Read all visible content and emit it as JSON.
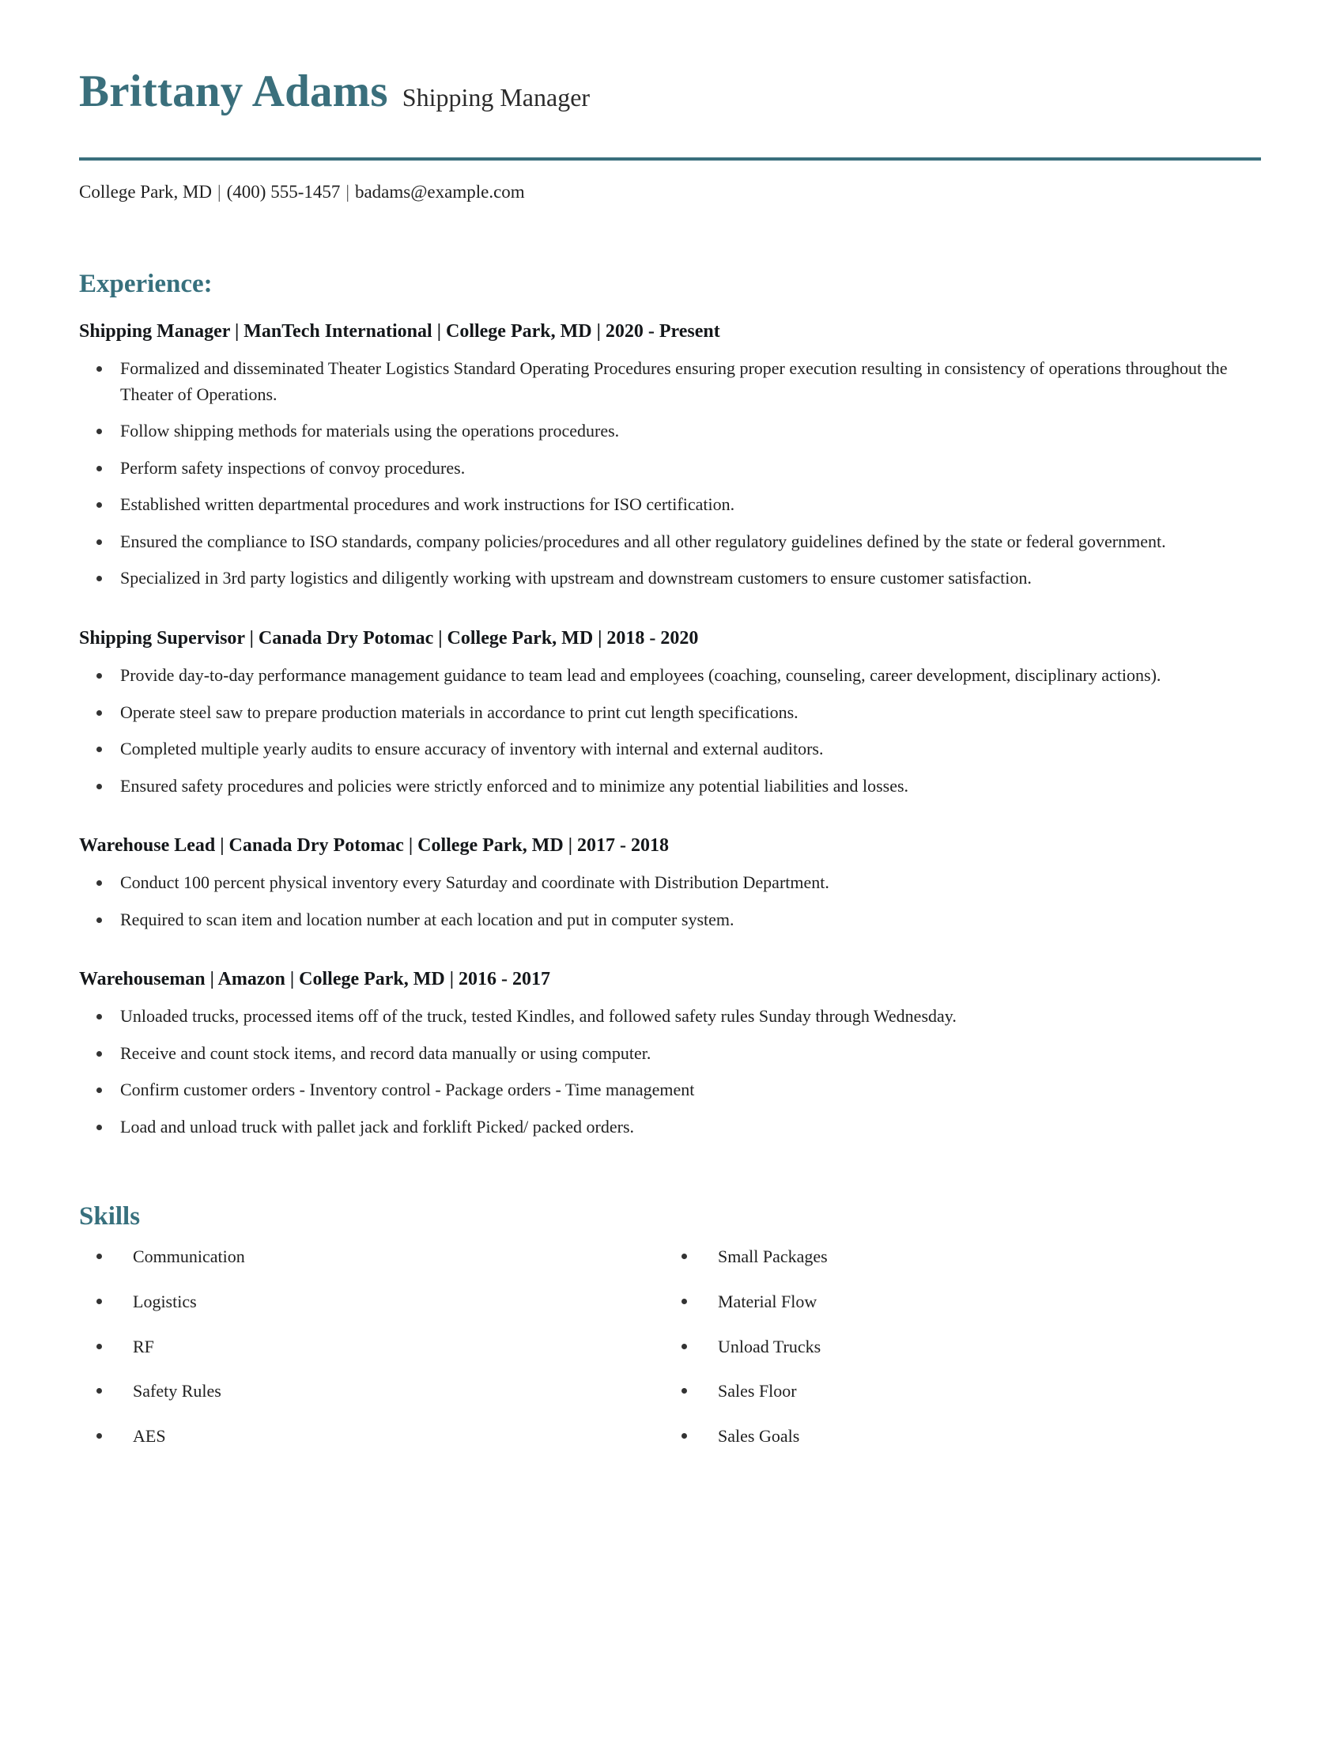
{
  "theme": {
    "accent": "#3a6f7c",
    "text": "#1f1f1f",
    "heading": "#37707d",
    "background": "#ffffff"
  },
  "header": {
    "name": "Brittany Adams",
    "title": "Shipping Manager",
    "contact": {
      "location": "College Park, MD",
      "phone": "(400) 555-1457",
      "email": "badams@example.com",
      "separator": "|"
    }
  },
  "experience": {
    "heading": "Experience:",
    "jobs": [
      {
        "heading": "Shipping Manager | ManTech International | College Park, MD | 2020 - Present",
        "position": "Shipping Manager",
        "company": "ManTech International",
        "location": "College Park, MD",
        "dates": "2020 - Present",
        "bullets": [
          "Formalized and disseminated Theater Logistics Standard Operating Procedures ensuring proper execution resulting in consistency of operations throughout the Theater of Operations.",
          "Follow shipping methods for materials using the operations procedures.",
          "Perform safety inspections of convoy procedures.",
          "Established written departmental procedures and work instructions for ISO certification.",
          "Ensured the compliance to ISO standards, company policies/procedures and all other regulatory guidelines defined by the state or federal government.",
          "Specialized in 3rd party logistics and diligently working with upstream and downstream customers to ensure customer satisfaction."
        ]
      },
      {
        "heading": "Shipping Supervisor | Canada Dry Potomac | College Park, MD | 2018 - 2020",
        "position": "Shipping Supervisor",
        "company": "Canada Dry Potomac",
        "location": "College Park, MD",
        "dates": "2018 - 2020",
        "bullets": [
          "Provide day-to-day performance management guidance to team lead and employees (coaching, counseling, career development, disciplinary actions).",
          "Operate steel saw to prepare production materials in accordance to print cut length specifications.",
          "Completed multiple yearly audits to ensure accuracy of inventory with internal and external auditors.",
          "Ensured safety procedures and policies were strictly enforced and to minimize any potential liabilities and losses."
        ]
      },
      {
        "heading": "Warehouse Lead | Canada Dry Potomac | College Park, MD | 2017 - 2018",
        "position": "Warehouse Lead",
        "company": "Canada Dry Potomac",
        "location": "College Park, MD",
        "dates": "2017 - 2018",
        "bullets": [
          "Conduct 100 percent physical inventory every Saturday and coordinate with Distribution Department.",
          "Required to scan item and location number at each location and put in computer system."
        ]
      },
      {
        "heading": "Warehouseman | Amazon | College Park, MD | 2016 - 2017",
        "position": "Warehouseman",
        "company": "Amazon",
        "location": "College Park, MD",
        "dates": "2016 - 2017",
        "bullets": [
          "Unloaded trucks, processed items off of the truck, tested Kindles, and followed safety rules Sunday through Wednesday.",
          "Receive and count stock items, and record data manually or using computer.",
          "Confirm customer orders - Inventory control - Package orders - Time management",
          "Load and unload truck with pallet jack and forklift Picked/ packed orders."
        ]
      }
    ]
  },
  "skills": {
    "heading": "Skills",
    "column_left": [
      "Communication",
      "Logistics",
      "RF",
      "Safety Rules",
      "AES"
    ],
    "column_right": [
      "Small Packages",
      "Material Flow",
      "Unload Trucks",
      "Sales Floor",
      "Sales Goals"
    ]
  }
}
